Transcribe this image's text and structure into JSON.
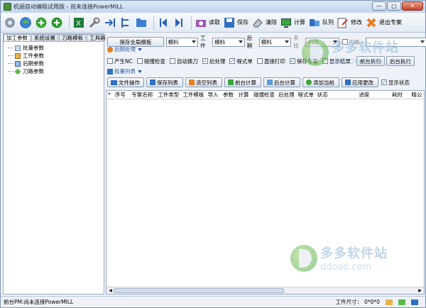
{
  "window": {
    "title": "机胡自动编程试用版 - 尚未连接PowerMILL",
    "controls": {
      "minimize": "—",
      "maximize": "□",
      "close": "✕"
    }
  },
  "toolbar": {
    "items": [
      {
        "name": "gear-icon",
        "label": ""
      },
      {
        "name": "globe-icon",
        "label": ""
      },
      {
        "name": "add-icon",
        "label": ""
      },
      {
        "name": "add-green-icon",
        "label": ""
      },
      {
        "name": "excel-icon",
        "label": ""
      },
      {
        "name": "wrench-icon",
        "label": ""
      },
      {
        "name": "import-icon",
        "label": ""
      },
      {
        "name": "tree-icon",
        "label": ""
      },
      {
        "name": "folder-icon",
        "label": ""
      },
      {
        "name": "first-icon",
        "label": ""
      },
      {
        "name": "last-icon",
        "label": ""
      }
    ],
    "read": "读取",
    "save": "保存",
    "clear": "清除",
    "calculate": "计算",
    "queue": "队列",
    "modify": "修改",
    "exit": "退出专案"
  },
  "left_tabs": [
    "加工参数",
    "系统设置",
    "刀路模板",
    "工具箱"
  ],
  "tree": [
    "批量参数",
    "工件参数",
    "后期参数",
    "刀路参数"
  ],
  "top_row": {
    "save_template": "保存全局模板",
    "combo1": "模料",
    "workpiece_label": "工件",
    "combo2": "模料",
    "post_label": "后期",
    "combo3": "模料",
    "system_label": "系统",
    "combo4": "机胡",
    "toolpath_label": "刀路"
  },
  "post_section": "后期处理",
  "checks": [
    {
      "label": "产生NC",
      "checked": false
    },
    {
      "label": "碰撞检查",
      "checked": false
    },
    {
      "label": "自动换刀",
      "checked": false
    },
    {
      "label": "后处理",
      "checked": true
    },
    {
      "label": "程式单",
      "checked": true
    },
    {
      "label": "直接打印",
      "checked": false
    },
    {
      "label": "保存专案",
      "checked": true
    },
    {
      "label": "显示结果",
      "checked": false
    }
  ],
  "bg_buttons": [
    "前台执行",
    "后台执行"
  ],
  "batch_section": "批量列表",
  "action_buttons": [
    "文件操作",
    "保存列表",
    "清空列表",
    "前台计算",
    "后台计算",
    "添加当前",
    "应用更改"
  ],
  "show_status": {
    "label": "显示状态",
    "checked": true
  },
  "columns": [
    "序号",
    "专案名称",
    "工件类型",
    "工件模板",
    "导入",
    "参数",
    "计算",
    "碰撞检查",
    "后处理",
    "程式单",
    "状态",
    "进度",
    "耗时",
    "精公"
  ],
  "status": {
    "left": "前台PM:尚未连接PowerMILL",
    "size_label": "工件尺寸：",
    "size_value": "0*0*0"
  },
  "watermark": {
    "cn": "多多软件站",
    "en": "ddooo.com"
  }
}
